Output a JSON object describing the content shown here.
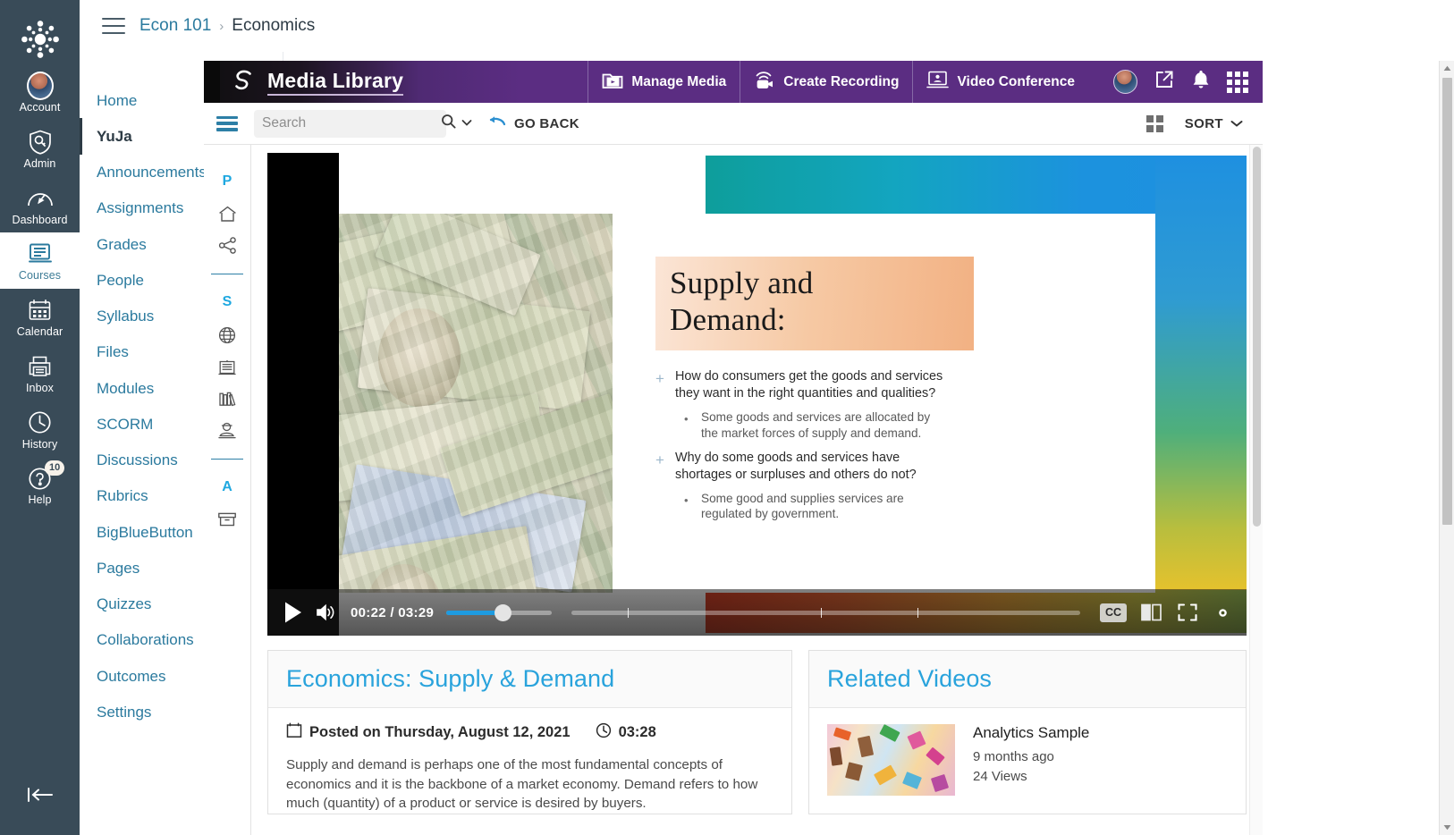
{
  "global_nav": {
    "logo": "canvas-logo",
    "items": [
      {
        "label": "Account",
        "icon": "avatar-icon",
        "active": false
      },
      {
        "label": "Admin",
        "icon": "shield-key-icon",
        "active": false
      },
      {
        "label": "Dashboard",
        "icon": "dashboard-gauge-icon",
        "active": false
      },
      {
        "label": "Courses",
        "icon": "courses-icon",
        "active": true
      },
      {
        "label": "Calendar",
        "icon": "calendar-icon",
        "active": false
      },
      {
        "label": "Inbox",
        "icon": "inbox-icon",
        "active": false
      },
      {
        "label": "History",
        "icon": "clock-icon",
        "active": false
      },
      {
        "label": "Help",
        "icon": "question-icon",
        "active": false,
        "badge": "10"
      }
    ],
    "collapse_label": "collapse-nav-icon"
  },
  "breadcrumb": {
    "menu_icon": "hamburger-icon",
    "course": "Econ 101",
    "separator": "›",
    "current": "Economics"
  },
  "course_nav": {
    "items": [
      {
        "label": "Home",
        "active": false,
        "hidden_icon": false
      },
      {
        "label": "YuJa",
        "active": true,
        "hidden_icon": false
      },
      {
        "label": "Announcements",
        "active": false,
        "hidden_icon": false
      },
      {
        "label": "Assignments",
        "active": false,
        "hidden_icon": false
      },
      {
        "label": "Grades",
        "active": false,
        "hidden_icon": false
      },
      {
        "label": "People",
        "active": false,
        "hidden_icon": false
      },
      {
        "label": "Syllabus",
        "active": false,
        "hidden_icon": false
      },
      {
        "label": "Files",
        "active": false,
        "hidden_icon": false
      },
      {
        "label": "Modules",
        "active": false,
        "hidden_icon": false
      },
      {
        "label": "SCORM",
        "active": false,
        "hidden_icon": false
      },
      {
        "label": "Discussions",
        "active": false,
        "hidden_icon": false
      },
      {
        "label": "Rubrics",
        "active": false,
        "hidden_icon": false
      },
      {
        "label": "BigBlueButton",
        "active": false,
        "hidden_icon": true
      },
      {
        "label": "Pages",
        "active": false,
        "hidden_icon": true
      },
      {
        "label": "Quizzes",
        "active": false,
        "hidden_icon": true
      },
      {
        "label": "Collaborations",
        "active": false,
        "hidden_icon": true
      },
      {
        "label": "Outcomes",
        "active": false,
        "hidden_icon": true
      },
      {
        "label": "Settings",
        "active": false,
        "hidden_icon": false
      }
    ]
  },
  "media_library": {
    "brand": "Media Library",
    "brand_icon": "yuja-spiral-logo",
    "actions": [
      {
        "label": "Manage Media",
        "icon": "media-folder-icon"
      },
      {
        "label": "Create Recording",
        "icon": "record-camera-icon"
      },
      {
        "label": "Video Conference",
        "icon": "video-conference-icon"
      }
    ],
    "right_icons": [
      "user-avatar",
      "external-link-icon",
      "bell-icon",
      "apps-grid-icon"
    ],
    "toolbar": {
      "menu_icon": "list-menu-icon",
      "search_placeholder": "Search",
      "search_value": "",
      "search_icon": "search-icon",
      "search_dropdown_icon": "chevron-down-icon",
      "go_back_label": "GO BACK",
      "go_back_icon": "arrow-back-icon",
      "view_grid_icon": "grid-view-icon",
      "sort_label": "SORT",
      "sort_icon": "caret-down-icon"
    },
    "rail": {
      "groups": [
        {
          "letter": "P",
          "icons": [
            "home-icon",
            "share-icon"
          ]
        },
        {
          "letter": "S",
          "icons": [
            "globe-icon",
            "institution-icon",
            "library-books-icon",
            "person-lecture-icon"
          ]
        },
        {
          "letter": "A",
          "icons": [
            "archive-box-icon"
          ]
        }
      ]
    }
  },
  "player": {
    "play_icon": "play-icon",
    "volume_icon": "volume-on-icon",
    "time": "00:22 / 03:29",
    "cc_label": "CC",
    "cc_icon": "closed-caption-icon",
    "layout_icon": "side-by-side-layout-icon",
    "fullscreen_icon": "fullscreen-icon",
    "settings_icon": "gear-icon",
    "volume_percent": 50,
    "progress_percent": 10
  },
  "slide": {
    "title_line1": "Supply and",
    "title_line2": "Demand:",
    "bullets": [
      {
        "level": 1,
        "marker": "+",
        "text": "How do consumers get the goods and services they want in the right quantities and qualities?"
      },
      {
        "level": 2,
        "marker": "•",
        "text": "Some goods and services are allocated by the market forces of supply and demand."
      },
      {
        "level": 1,
        "marker": "+",
        "text": "Why do some goods and services have shortages or surpluses and others do not?"
      },
      {
        "level": 2,
        "marker": "•",
        "text": "Some good and supplies services are regulated by government."
      }
    ],
    "image_alt": "currency-banknotes-collage"
  },
  "video_details": {
    "title": "Economics: Supply & Demand",
    "posted_label": "Posted on Thursday, August 12, 2021",
    "posted_icon": "calendar-icon",
    "duration": "03:28",
    "duration_icon": "clock-icon",
    "description": "Supply and demand is perhaps one of the most fundamental concepts of economics and it is the backbone of a market economy. Demand refers to how much (quantity) of a product or service is desired by buyers."
  },
  "related_videos": {
    "title": "Related Videos",
    "items": [
      {
        "title": "Analytics Sample",
        "age": "9 months ago",
        "views": "24 Views",
        "thumb_alt": "colorful-confetti-thumbnail"
      }
    ]
  },
  "colors": {
    "canvas_nav_bg": "#394B58",
    "link_blue": "#2B7A9E",
    "yuja_purple": "#5B2D82",
    "accent_cyan": "#29A3DC",
    "rail_blue": "#1FA8E0"
  }
}
